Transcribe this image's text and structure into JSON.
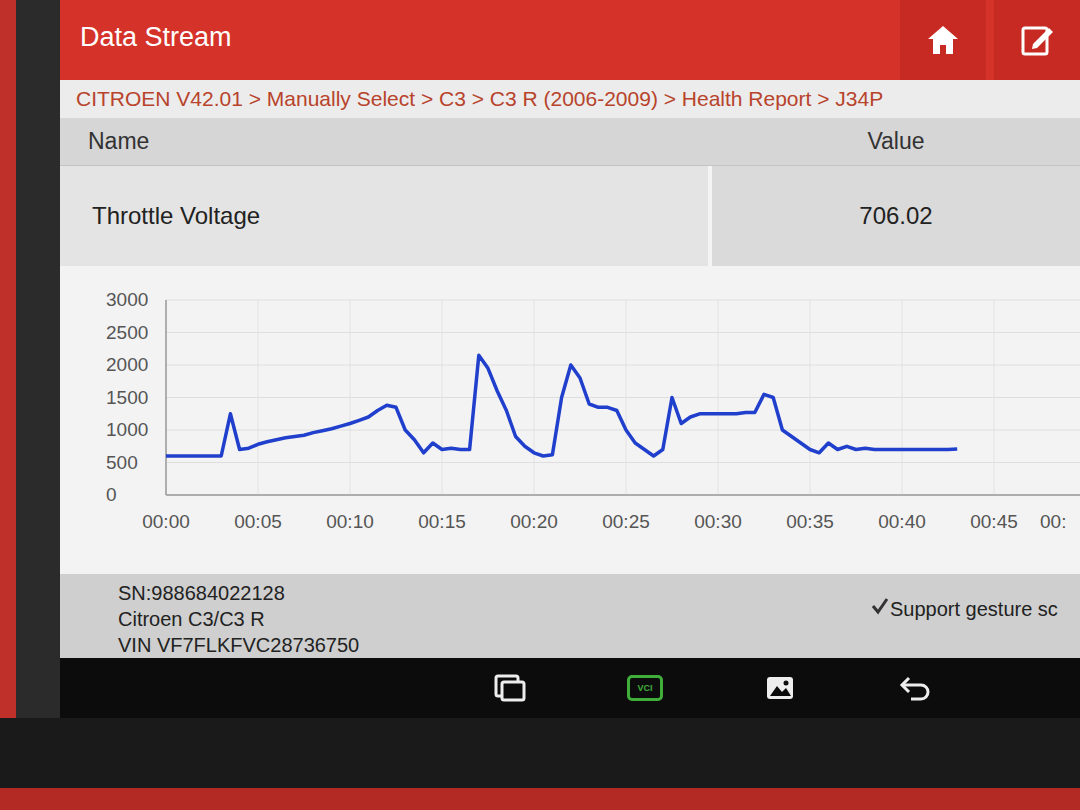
{
  "header": {
    "title": "Data Stream"
  },
  "breadcrumb": "CITROEN V42.01 > Manually Select > C3 > C3 R (2006-2009) > Health Report > J34P",
  "table": {
    "columns": [
      "Name",
      "Value"
    ],
    "rows": [
      [
        "Throttle Voltage",
        "706.02"
      ]
    ]
  },
  "chart": {
    "y_ticks": [
      "3000",
      "2500",
      "2000",
      "1500",
      "1000",
      "500",
      "0"
    ],
    "x_ticks": [
      "00:00",
      "00:05",
      "00:10",
      "00:15",
      "00:20",
      "00:25",
      "00:30",
      "00:35",
      "00:40",
      "00:45",
      "00:"
    ],
    "series": [
      {
        "values": [
          600,
          600,
          600,
          600,
          600,
          600,
          600,
          1250,
          700,
          720,
          780,
          820,
          850,
          880,
          900,
          920,
          960,
          990,
          1020,
          1060,
          1100,
          1150,
          1200,
          1300,
          1380,
          1350,
          1000,
          850,
          650,
          800,
          700,
          720,
          700,
          700,
          2150,
          1950,
          1600,
          1300,
          900,
          750,
          650,
          600,
          620,
          1500,
          2000,
          1800,
          1400,
          1350,
          1350,
          1300,
          1000,
          800,
          700,
          600,
          700,
          1500,
          1100,
          1200,
          1250,
          1250,
          1250,
          1250,
          1250,
          1270,
          1270,
          1550,
          1500,
          1000,
          900,
          800,
          700,
          650,
          800,
          700,
          750,
          700,
          720,
          700,
          700,
          700,
          700,
          700,
          700,
          700,
          700,
          700,
          706
        ]
      }
    ]
  },
  "footer": {
    "lines": [
      "SN:988684022128",
      "Citroen C3/C3 R",
      "VIN VF7FLKFVC28736750"
    ],
    "gesture": "Support gesture sc"
  },
  "nav": {
    "vci_label": "VCI"
  }
}
